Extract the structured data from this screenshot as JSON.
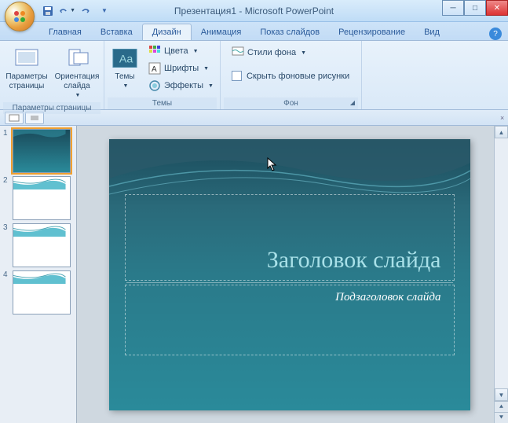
{
  "window": {
    "title": "Презентация1 - Microsoft PowerPoint"
  },
  "tabs": {
    "home": "Главная",
    "insert": "Вставка",
    "design": "Дизайн",
    "animation": "Анимация",
    "slideshow": "Показ слайдов",
    "review": "Рецензирование",
    "view": "Вид",
    "active": "design"
  },
  "ribbon": {
    "page_setup": {
      "label": "Параметры страницы",
      "page_params_btn": "Параметры страницы",
      "orientation_btn": "Ориентация слайда"
    },
    "themes": {
      "label": "Темы",
      "themes_btn": "Темы",
      "colors_btn": "Цвета",
      "fonts_btn": "Шрифты",
      "effects_btn": "Эффекты"
    },
    "background": {
      "label": "Фон",
      "styles_btn": "Стили фона",
      "hide_graphics": "Скрыть фоновые рисунки"
    }
  },
  "slide": {
    "title_placeholder": "Заголовок слайда",
    "subtitle_placeholder": "Подзаголовок слайда"
  },
  "thumbnails": {
    "count": 4,
    "selected": 1,
    "items": [
      "1",
      "2",
      "3",
      "4"
    ]
  }
}
